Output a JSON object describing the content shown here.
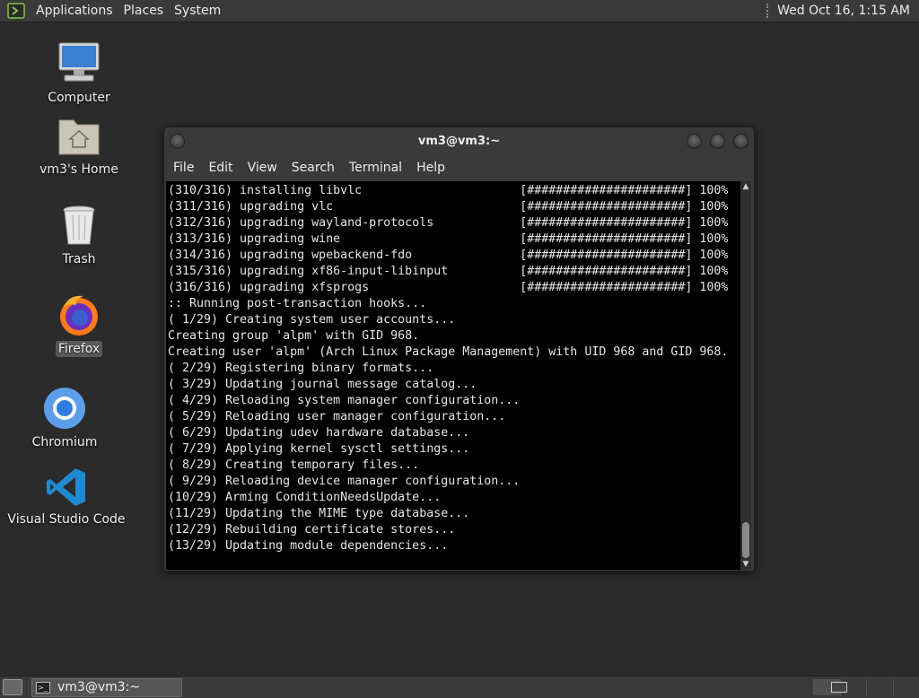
{
  "top_panel": {
    "menus": [
      "Applications",
      "Places",
      "System"
    ],
    "clock": "Wed Oct 16,  1:15 AM"
  },
  "desktop_icons": [
    {
      "label": "Computer",
      "icon": "computer-icon"
    },
    {
      "label": "vm3's Home",
      "icon": "home-folder-icon"
    },
    {
      "label": "Trash",
      "icon": "trash-icon"
    },
    {
      "label": "Firefox",
      "icon": "firefox-icon",
      "selected": true
    },
    {
      "label": "Chromium",
      "icon": "chromium-icon"
    },
    {
      "label": "Visual Studio Code",
      "icon": "vscode-icon"
    }
  ],
  "terminal": {
    "title": "vm3@vm3:~",
    "menus": [
      "File",
      "Edit",
      "View",
      "Search",
      "Terminal",
      "Help"
    ],
    "lines": [
      "(310/316) installing libvlc                      [######################] 100%",
      "(311/316) upgrading vlc                          [######################] 100%",
      "(312/316) upgrading wayland-protocols            [######################] 100%",
      "(313/316) upgrading wine                         [######################] 100%",
      "(314/316) upgrading wpebackend-fdo               [######################] 100%",
      "(315/316) upgrading xf86-input-libinput          [######################] 100%",
      "(316/316) upgrading xfsprogs                     [######################] 100%",
      ":: Running post-transaction hooks...",
      "( 1/29) Creating system user accounts...",
      "Creating group 'alpm' with GID 968.",
      "Creating user 'alpm' (Arch Linux Package Management) with UID 968 and GID 968.",
      "( 2/29) Registering binary formats...",
      "( 3/29) Updating journal message catalog...",
      "( 4/29) Reloading system manager configuration...",
      "( 5/29) Reloading user manager configuration...",
      "( 6/29) Updating udev hardware database...",
      "( 7/29) Applying kernel sysctl settings...",
      "( 8/29) Creating temporary files...",
      "( 9/29) Reloading device manager configuration...",
      "(10/29) Arming ConditionNeedsUpdate...",
      "(11/29) Updating the MIME type database...",
      "(12/29) Rebuilding certificate stores...",
      "(13/29) Updating module dependencies..."
    ]
  },
  "taskbar": {
    "window_label": "vm3@vm3:~"
  }
}
